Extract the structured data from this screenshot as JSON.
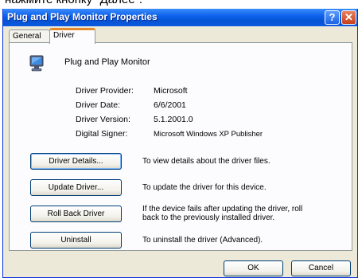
{
  "caption": "нажмите кнопку \"Далее\".",
  "window": {
    "title": "Plug and Play Monitor Properties",
    "help_glyph": "?",
    "close_glyph": "✕"
  },
  "tabs": [
    {
      "label": "General"
    },
    {
      "label": "Driver"
    }
  ],
  "device": {
    "name": "Plug and Play Monitor",
    "icon": "monitor-icon"
  },
  "driver_info": {
    "provider_label": "Driver Provider:",
    "provider_value": "Microsoft",
    "date_label": "Driver Date:",
    "date_value": "6/6/2001",
    "version_label": "Driver Version:",
    "version_value": "5.1.2001.0",
    "signer_label": "Digital Signer:",
    "signer_value": "Microsoft Windows XP Publisher"
  },
  "actions": [
    {
      "label": "Driver Details...",
      "description": "To view details about the driver files."
    },
    {
      "label": "Update Driver...",
      "description": "To update the driver for this device."
    },
    {
      "label": "Roll Back Driver",
      "description_line1": "If the device fails after updating the driver, roll",
      "description_line2": "back to the previously installed driver."
    },
    {
      "label": "Uninstall",
      "description": "To uninstall the driver (Advanced)."
    }
  ],
  "footer": {
    "ok_label": "OK",
    "cancel_label": "Cancel"
  }
}
